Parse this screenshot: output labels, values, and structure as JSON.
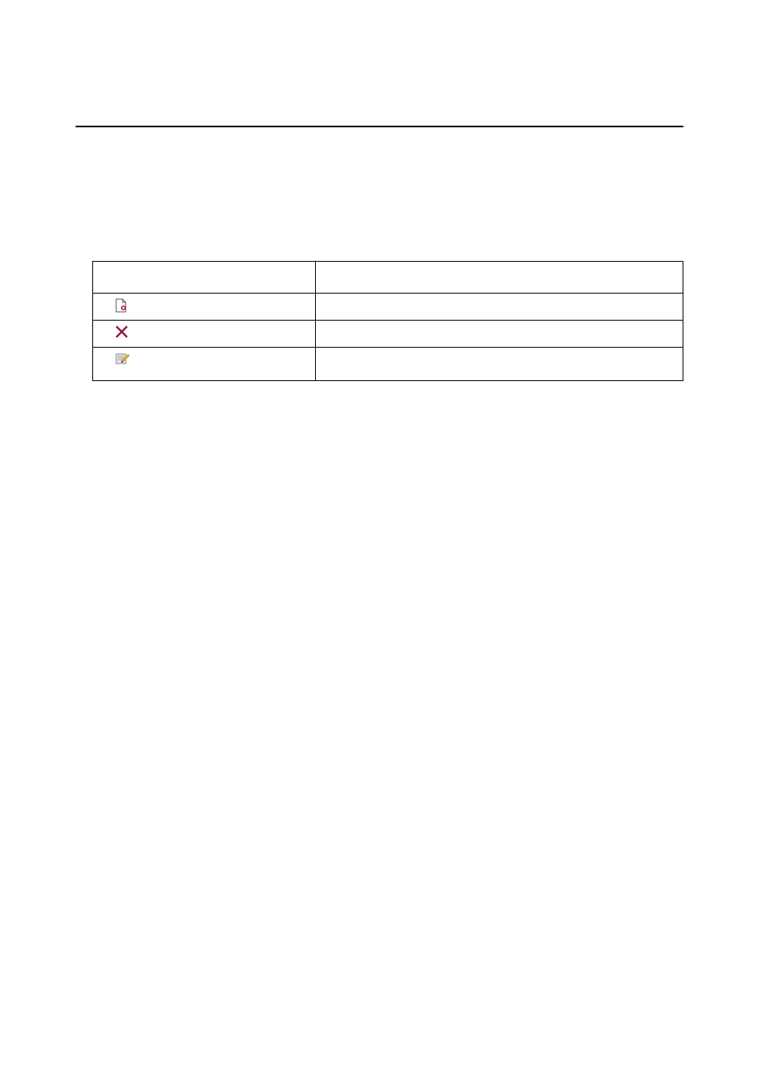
{
  "table": {
    "header": {
      "col1": "",
      "col2": ""
    },
    "rows": [
      {
        "icon": "new-doc-icon",
        "desc": ""
      },
      {
        "icon": "delete-x-icon",
        "desc": ""
      },
      {
        "icon": "edit-pencil-icon",
        "desc": ""
      }
    ]
  }
}
